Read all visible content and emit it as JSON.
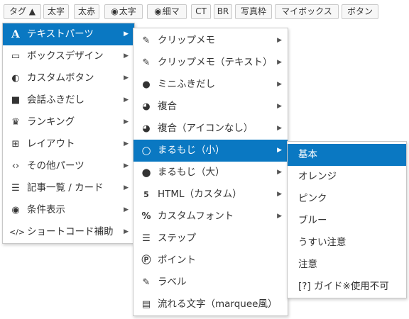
{
  "toolbar": {
    "buttons": [
      {
        "label": "タグ ▲",
        "icon": ""
      },
      {
        "label": "太字",
        "icon": ""
      },
      {
        "label": "太赤",
        "icon": ""
      },
      {
        "label": "太字",
        "icon": "user-circle-icon"
      },
      {
        "label": "細マ",
        "icon": "user-circle-icon"
      },
      {
        "label": "CT",
        "icon": ""
      },
      {
        "label": "BR",
        "icon": ""
      },
      {
        "label": "写真枠",
        "icon": ""
      },
      {
        "label": "マイボックス",
        "icon": ""
      },
      {
        "label": "ボタン",
        "icon": ""
      }
    ]
  },
  "menu1": {
    "items": [
      {
        "label": "テキストパーツ",
        "icon": "font-a-icon",
        "active": true
      },
      {
        "label": "ボックスデザイン",
        "icon": "inbox-icon"
      },
      {
        "label": "カスタムボタン",
        "icon": "toggle-icon"
      },
      {
        "label": "会話ふきだし",
        "icon": "comments-icon"
      },
      {
        "label": "ランキング",
        "icon": "crown-icon"
      },
      {
        "label": "レイアウト",
        "icon": "grid-icon"
      },
      {
        "label": "その他パーツ",
        "icon": "code-icon"
      },
      {
        "label": "記事一覧 / カード",
        "icon": "list-icon"
      },
      {
        "label": "条件表示",
        "icon": "eye-icon"
      },
      {
        "label": "ショートコード補助",
        "icon": "code-slash-icon"
      }
    ]
  },
  "menu2": {
    "items": [
      {
        "label": "クリップメモ",
        "icon": "paperclip-icon",
        "submenu": true
      },
      {
        "label": "クリップメモ（テキスト）",
        "icon": "paperclip-icon",
        "submenu": true
      },
      {
        "label": "ミニふきだし",
        "icon": "comment-dots-icon",
        "submenu": true
      },
      {
        "label": "複合",
        "icon": "pie-icon",
        "submenu": true
      },
      {
        "label": "複合（アイコンなし）",
        "icon": "pie-icon",
        "submenu": true
      },
      {
        "label": "まるもじ（小）",
        "icon": "circle-outline-icon",
        "submenu": true,
        "active": true
      },
      {
        "label": "まるもじ（大）",
        "icon": "circle-filled-icon",
        "submenu": true
      },
      {
        "label": "HTML（カスタム）",
        "icon": "html5-icon",
        "submenu": true
      },
      {
        "label": "カスタムフォント",
        "icon": "percent-icon",
        "submenu": true
      },
      {
        "label": "ステップ",
        "icon": "list-ol-icon"
      },
      {
        "label": "ポイント",
        "icon": "p-circle-icon"
      },
      {
        "label": "ラベル",
        "icon": "pencil-square-icon"
      },
      {
        "label": "流れる文字（marquee風）",
        "icon": "newspaper-icon"
      }
    ]
  },
  "menu3": {
    "items": [
      {
        "label": "基本",
        "active": true
      },
      {
        "label": "オレンジ"
      },
      {
        "label": "ピンク"
      },
      {
        "label": "ブルー"
      },
      {
        "label": "うすい注意"
      },
      {
        "label": "注意"
      },
      {
        "label": "[?] ガイド※使用不可"
      }
    ]
  },
  "colors": {
    "accent": "#0a78c2",
    "border": "#c8c8c8"
  }
}
